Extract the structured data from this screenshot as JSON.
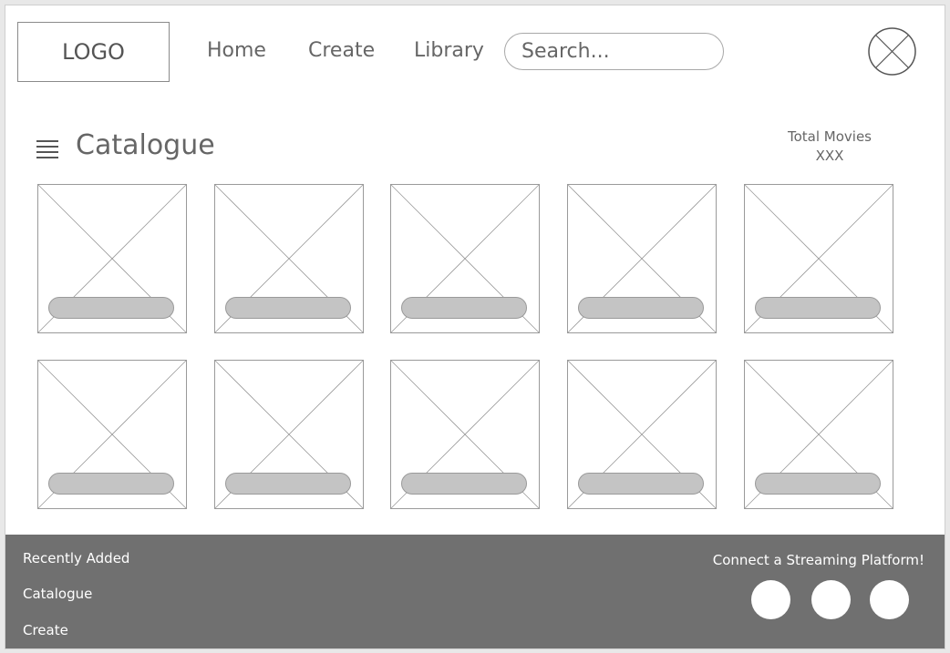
{
  "header": {
    "logo": "LOGO",
    "nav": [
      "Home",
      "Create",
      "Library"
    ],
    "search_placeholder": "Search..."
  },
  "catalogue": {
    "title": "Catalogue",
    "total_label": "Total Movies",
    "total_value": "XXX",
    "movie_count": 10
  },
  "footer": {
    "links": [
      "Recently Added",
      "Catalogue",
      "Create"
    ],
    "connect_label": "Connect a Streaming Platform!",
    "platform_count": 3
  },
  "colors": {
    "footer_bg": "#707070",
    "placeholder_line": "#9a9a9a",
    "pill": "#c4c4c4"
  },
  "icons": {
    "menu": "hamburger-menu-icon",
    "avatar": "profile-placeholder-icon"
  }
}
